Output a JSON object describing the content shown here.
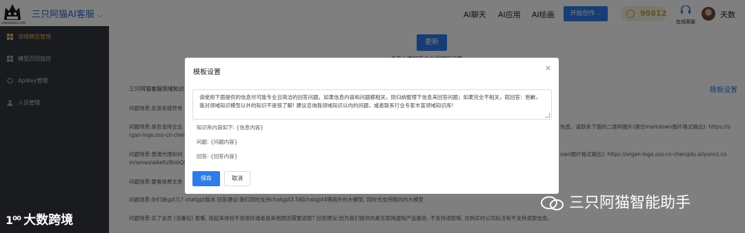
{
  "header": {
    "logo_caption": "JIANGBIMAO.COM",
    "app_title": "三只阿猫AI客服",
    "nav": [
      "AI聊天",
      "AI应用",
      "AI绘画"
    ],
    "start_button": "开始创作",
    "coins": "99812",
    "service_label": "在线客服",
    "username": "天数"
  },
  "sidebar": {
    "items": [
      {
        "label": "领域模型管理",
        "icon": "grid-icon",
        "active": true
      },
      {
        "label": "模型召回监控",
        "icon": "monitor-icon",
        "active": false
      },
      {
        "label": "ApiKey管理",
        "icon": "key-icon",
        "active": false
      },
      {
        "label": "人员管理",
        "icon": "user-icon",
        "active": false
      }
    ]
  },
  "main": {
    "update_button": "更新",
    "sub_text": "点击上传您的企业领域知识库",
    "template_link": "模板设置",
    "kb_title": "三只阿猫客服领域知识",
    "rows": [
      {
        "line1": "问题场景:反馈系统异常"
      },
      {
        "line1": "问题场景:是否支持企业",
        "line1_right": "信息。请联系下面的二维码图片(通过markdown图片格式输出): https://o",
        "line2": "rgan-logo.oss-cn-chen"
      },
      {
        "line1": "问题场景:普通代理如何",
        "line1_right": "own图片格式输出): https://organ-logo.oss-cn-chengdu.aliyuncs.co",
        "line2": "m/amao/aikefu/BobQi"
      },
      {
        "line1": "问题场景:要看收费太贵"
      },
      {
        "line1": "问题场景:你们是gpt几? chatgpt版本 回答建议:我们同时支持chatgpt3.5和chatgpt4等国外的大模型, 同时也支持国内的大模型"
      },
      {
        "line1": "问题场景:买了会员 (流量包) 套餐, 用起来体验不是很好或者是其他原因需要退款? 回答建议:因为我们提供的是互联网虚拟产品服务, 不支持退款哦, 在购买时公司标注有不支持退款信息。"
      }
    ]
  },
  "modal": {
    "title": "模板设置",
    "template_text": "请使用下面提供的信息尽可能专业且简洁的回答问题。如果信息内容和问题都相关，则归纳整理下信息来回答问题；如果完全不相关，就回答：抱歉，我对领域知识模型以外的知识不是很了解! 建议咨询我领域知识以内的问题，或者联系行业专家丰富领域知识库!",
    "kb_line": "知识库内容如下: {信息内容}",
    "question_line": "问题: {问题内容}",
    "answer_line": "回答: {回答内容}",
    "save_button": "保存",
    "cancel_button": "取消"
  },
  "watermarks": {
    "left_mark": "1⁰⁰",
    "left_text": "大数跨境",
    "right_text": "三只阿猫智能助手"
  }
}
